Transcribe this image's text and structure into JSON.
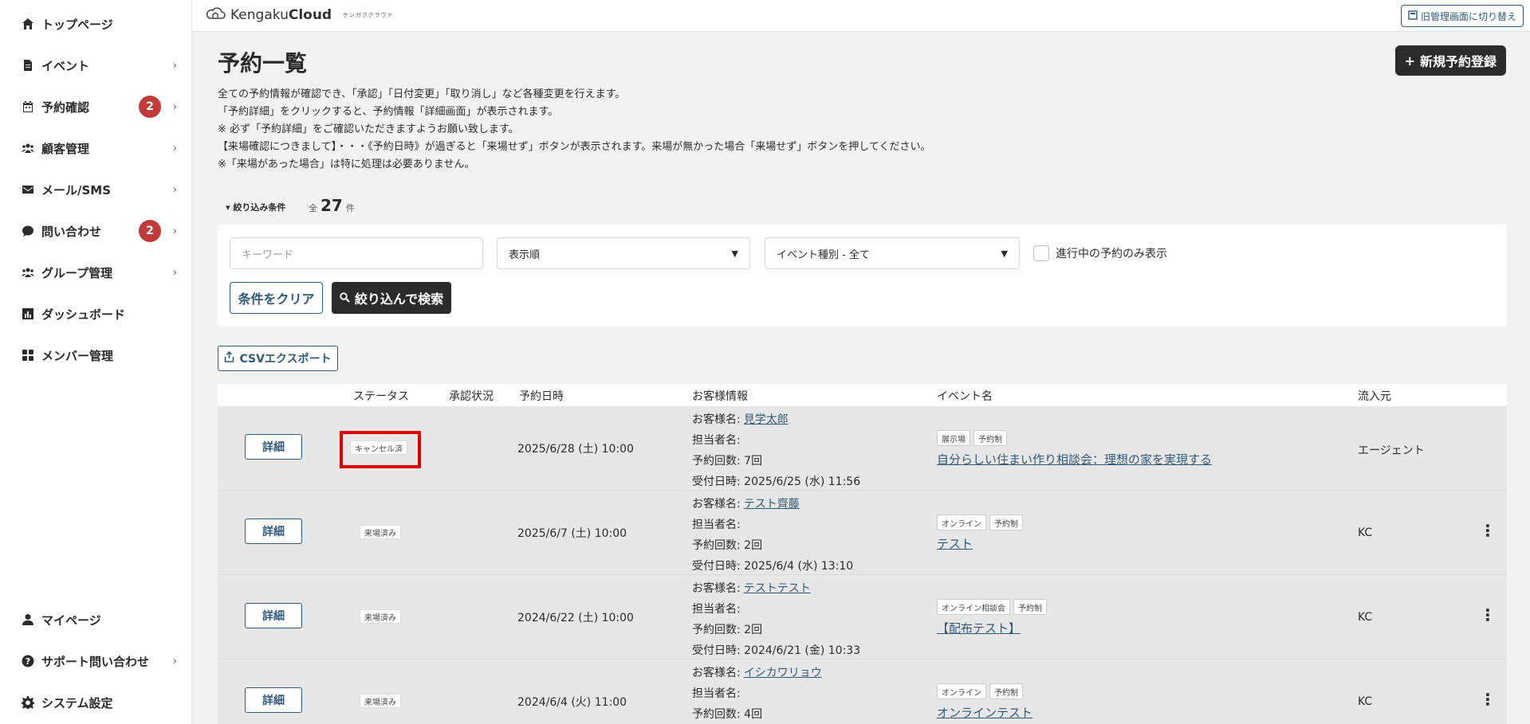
{
  "app": {
    "brand_light": "Kengaku",
    "brand_bold": "Cloud",
    "brand_kana": "ケンガククラウド",
    "switch_label": "旧管理画面に切り替え"
  },
  "sidebar": {
    "items": [
      {
        "label": "トップページ",
        "icon": "home-icon",
        "chevron": ""
      },
      {
        "label": "イベント",
        "icon": "file-icon",
        "chevron": "›"
      },
      {
        "label": "予約確認",
        "icon": "calendar-icon",
        "chevron": "›",
        "badge": "2"
      },
      {
        "label": "顧客管理",
        "icon": "users-icon",
        "chevron": "›"
      },
      {
        "label": "メール/SMS",
        "icon": "mail-icon",
        "chevron": "›"
      },
      {
        "label": "問い合わせ",
        "icon": "chat-icon",
        "chevron": "›",
        "badge": "2"
      },
      {
        "label": "グループ管理",
        "icon": "group-icon",
        "chevron": "›"
      },
      {
        "label": "ダッシュボード",
        "icon": "chart-icon",
        "chevron": ""
      },
      {
        "label": "メンバー管理",
        "icon": "grid-icon",
        "chevron": ""
      }
    ],
    "bottom": [
      {
        "label": "マイページ",
        "icon": "user-icon",
        "chevron": ""
      },
      {
        "label": "サポート問い合わせ",
        "icon": "help-icon",
        "chevron": "›"
      },
      {
        "label": "システム設定",
        "icon": "gear-icon",
        "chevron": ""
      }
    ]
  },
  "page": {
    "title": "予約一覧",
    "new_button": "新規予約登録",
    "description": [
      "全ての予約情報が確認でき、「承認」「日付変更」「取り消し」など各種変更を行えます。",
      "「予約詳細」をクリックすると、予約情報「詳細画面」が表示されます。",
      "※ 必ず「予約詳細」をご確認いただきますようお願い致します。",
      "【来場確認につきまして】・・・《予約日時》が過ぎると「来場せず」ボタンが表示されます。来場が無かった場合「来場せず」ボタンを押してください。",
      "※「来場があった場合」は特に処理は必要ありません。"
    ]
  },
  "filter": {
    "toggle_label": "絞り込み条件",
    "count_prefix": "全",
    "count": "27",
    "count_suffix": "件",
    "keyword_placeholder": "キーワード",
    "sort_select": "表示順",
    "event_type_select": "イベント種別 - 全て",
    "only_active_label": "進行中の予約のみ表示",
    "clear_button": "条件をクリア",
    "search_button": "絞り込んで検索"
  },
  "csv_button": "CSVエクスポート",
  "table": {
    "headers": [
      "ステータス",
      "承認状況",
      "予約日時",
      "お客様情報",
      "イベント名",
      "流入元"
    ],
    "detail_label": "詳細",
    "customer_label": "お客様名:",
    "staff_label": "担当者名:",
    "rows": [
      {
        "status": "キャンセル済",
        "date": "2025/6/28 (土) 10:00",
        "customer": "見学太郎",
        "visits": "予約回数: 7回",
        "received": "受付日時: 2025/6/25 (水) 11:56",
        "tags": [
          "展示場",
          "予約制"
        ],
        "event": "自分らしい住まい作り相談会：理想の家を実現する",
        "source": "エージェント",
        "menu": ""
      },
      {
        "status": "来場済み",
        "date": "2025/6/7 (土) 10:00",
        "customer": "テスト齊藤",
        "visits": "予約回数: 2回",
        "received": "受付日時: 2025/6/4 (水) 13:10",
        "tags": [
          "オンライン",
          "予約制"
        ],
        "event": "テスト",
        "source": "KC",
        "menu": "⋮"
      },
      {
        "status": "来場済み",
        "date": "2024/6/22 (土) 10:00",
        "customer": "テストテスト",
        "visits": "予約回数: 2回",
        "received": "受付日時: 2024/6/21 (金) 10:33",
        "tags": [
          "オンライン相談会",
          "予約制"
        ],
        "event": "【配布テスト】",
        "source": "KC",
        "menu": "⋮"
      },
      {
        "status": "来場済み",
        "date": "2024/6/4 (火) 11:00",
        "customer": "イシカワリョウ",
        "visits": "予約回数: 4回",
        "received": "",
        "tags": [
          "オンライン",
          "予約制"
        ],
        "event": "オンラインテスト",
        "source": "KC",
        "menu": "⋮"
      }
    ]
  },
  "colors": {
    "accent": "#2f5a7a",
    "badge": "#c13a3a",
    "highlight": "#e30000",
    "dark": "#2b2b2b"
  }
}
